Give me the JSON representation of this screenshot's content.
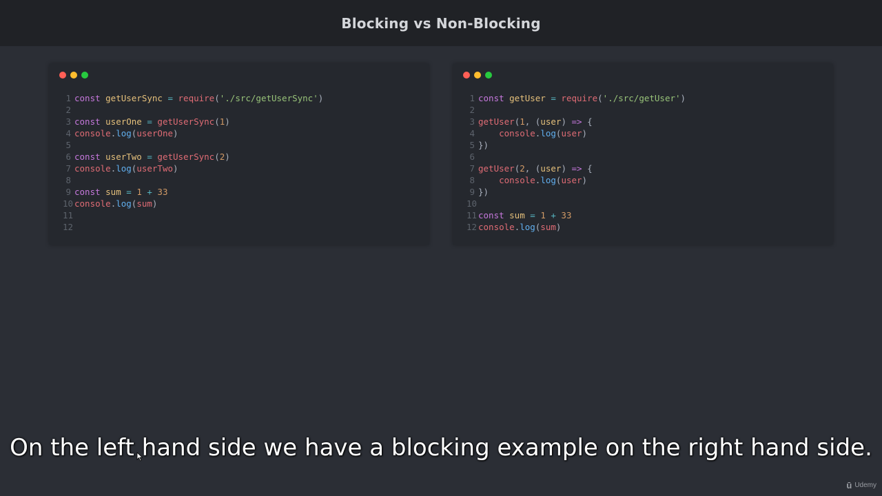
{
  "header": {
    "title": "Blocking vs Non-Blocking"
  },
  "colors": {
    "dot_close": "#ff5f56",
    "dot_minimize": "#ffbd2e",
    "dot_zoom": "#27c93f"
  },
  "left_editor": {
    "lines": [
      {
        "num": "1",
        "tokens": [
          {
            "c": "kw",
            "t": "const "
          },
          {
            "c": "var",
            "t": "getUserSync"
          },
          {
            "c": "op",
            "t": " = "
          },
          {
            "c": "fn",
            "t": "require"
          },
          {
            "c": "pun",
            "t": "("
          },
          {
            "c": "str",
            "t": "'./src/getUserSync'"
          },
          {
            "c": "pun",
            "t": ")"
          }
        ]
      },
      {
        "num": "2",
        "tokens": []
      },
      {
        "num": "3",
        "tokens": [
          {
            "c": "kw",
            "t": "const "
          },
          {
            "c": "var",
            "t": "userOne"
          },
          {
            "c": "op",
            "t": " = "
          },
          {
            "c": "fn",
            "t": "getUserSync"
          },
          {
            "c": "pun",
            "t": "("
          },
          {
            "c": "num",
            "t": "1"
          },
          {
            "c": "pun",
            "t": ")"
          }
        ]
      },
      {
        "num": "4",
        "tokens": [
          {
            "c": "obj",
            "t": "console"
          },
          {
            "c": "pun",
            "t": "."
          },
          {
            "c": "meth",
            "t": "log"
          },
          {
            "c": "pun",
            "t": "("
          },
          {
            "c": "obj",
            "t": "userOne"
          },
          {
            "c": "pun",
            "t": ")"
          }
        ]
      },
      {
        "num": "5",
        "tokens": []
      },
      {
        "num": "6",
        "tokens": [
          {
            "c": "kw",
            "t": "const "
          },
          {
            "c": "var",
            "t": "userTwo"
          },
          {
            "c": "op",
            "t": " = "
          },
          {
            "c": "fn",
            "t": "getUserSync"
          },
          {
            "c": "pun",
            "t": "("
          },
          {
            "c": "num",
            "t": "2"
          },
          {
            "c": "pun",
            "t": ")"
          }
        ]
      },
      {
        "num": "7",
        "tokens": [
          {
            "c": "obj",
            "t": "console"
          },
          {
            "c": "pun",
            "t": "."
          },
          {
            "c": "meth",
            "t": "log"
          },
          {
            "c": "pun",
            "t": "("
          },
          {
            "c": "obj",
            "t": "userTwo"
          },
          {
            "c": "pun",
            "t": ")"
          }
        ]
      },
      {
        "num": "8",
        "tokens": []
      },
      {
        "num": "9",
        "tokens": [
          {
            "c": "kw",
            "t": "const "
          },
          {
            "c": "var",
            "t": "sum"
          },
          {
            "c": "op",
            "t": " = "
          },
          {
            "c": "num",
            "t": "1"
          },
          {
            "c": "op",
            "t": " + "
          },
          {
            "c": "num",
            "t": "33"
          }
        ]
      },
      {
        "num": "10",
        "tokens": [
          {
            "c": "obj",
            "t": "console"
          },
          {
            "c": "pun",
            "t": "."
          },
          {
            "c": "meth",
            "t": "log"
          },
          {
            "c": "pun",
            "t": "("
          },
          {
            "c": "obj",
            "t": "sum"
          },
          {
            "c": "pun",
            "t": ")"
          }
        ]
      },
      {
        "num": "11",
        "tokens": []
      },
      {
        "num": "12",
        "tokens": []
      }
    ]
  },
  "right_editor": {
    "lines": [
      {
        "num": "1",
        "tokens": [
          {
            "c": "kw",
            "t": "const "
          },
          {
            "c": "var",
            "t": "getUser"
          },
          {
            "c": "op",
            "t": " = "
          },
          {
            "c": "fn",
            "t": "require"
          },
          {
            "c": "pun",
            "t": "("
          },
          {
            "c": "str",
            "t": "'./src/getUser'"
          },
          {
            "c": "pun",
            "t": ")"
          }
        ]
      },
      {
        "num": "2",
        "tokens": []
      },
      {
        "num": "3",
        "tokens": [
          {
            "c": "fn",
            "t": "getUser"
          },
          {
            "c": "pun",
            "t": "("
          },
          {
            "c": "num",
            "t": "1"
          },
          {
            "c": "pun",
            "t": ", ("
          },
          {
            "c": "var",
            "t": "user"
          },
          {
            "c": "pun",
            "t": ") "
          },
          {
            "c": "kw",
            "t": "=>"
          },
          {
            "c": "pun",
            "t": " {"
          }
        ]
      },
      {
        "num": "4",
        "tokens": [
          {
            "c": "plain",
            "t": "    "
          },
          {
            "c": "obj",
            "t": "console"
          },
          {
            "c": "pun",
            "t": "."
          },
          {
            "c": "meth",
            "t": "log"
          },
          {
            "c": "pun",
            "t": "("
          },
          {
            "c": "obj",
            "t": "user"
          },
          {
            "c": "pun",
            "t": ")"
          }
        ]
      },
      {
        "num": "5",
        "tokens": [
          {
            "c": "pun",
            "t": "})"
          }
        ]
      },
      {
        "num": "6",
        "tokens": []
      },
      {
        "num": "7",
        "tokens": [
          {
            "c": "fn",
            "t": "getUser"
          },
          {
            "c": "pun",
            "t": "("
          },
          {
            "c": "num",
            "t": "2"
          },
          {
            "c": "pun",
            "t": ", ("
          },
          {
            "c": "var",
            "t": "user"
          },
          {
            "c": "pun",
            "t": ") "
          },
          {
            "c": "kw",
            "t": "=>"
          },
          {
            "c": "pun",
            "t": " {"
          }
        ]
      },
      {
        "num": "8",
        "tokens": [
          {
            "c": "plain",
            "t": "    "
          },
          {
            "c": "obj",
            "t": "console"
          },
          {
            "c": "pun",
            "t": "."
          },
          {
            "c": "meth",
            "t": "log"
          },
          {
            "c": "pun",
            "t": "("
          },
          {
            "c": "obj",
            "t": "user"
          },
          {
            "c": "pun",
            "t": ")"
          }
        ]
      },
      {
        "num": "9",
        "tokens": [
          {
            "c": "pun",
            "t": "})"
          }
        ]
      },
      {
        "num": "10",
        "tokens": []
      },
      {
        "num": "11",
        "tokens": [
          {
            "c": "kw",
            "t": "const "
          },
          {
            "c": "var",
            "t": "sum"
          },
          {
            "c": "op",
            "t": " = "
          },
          {
            "c": "num",
            "t": "1"
          },
          {
            "c": "op",
            "t": " + "
          },
          {
            "c": "num",
            "t": "33"
          }
        ]
      },
      {
        "num": "12",
        "tokens": [
          {
            "c": "obj",
            "t": "console"
          },
          {
            "c": "pun",
            "t": "."
          },
          {
            "c": "meth",
            "t": "log"
          },
          {
            "c": "pun",
            "t": "("
          },
          {
            "c": "obj",
            "t": "sum"
          },
          {
            "c": "pun",
            "t": ")"
          }
        ]
      }
    ]
  },
  "caption": {
    "text": "On the left hand side we have a blocking example on the right hand side."
  },
  "watermark": {
    "icon": "udemy-logo-icon",
    "label": "Udemy"
  }
}
